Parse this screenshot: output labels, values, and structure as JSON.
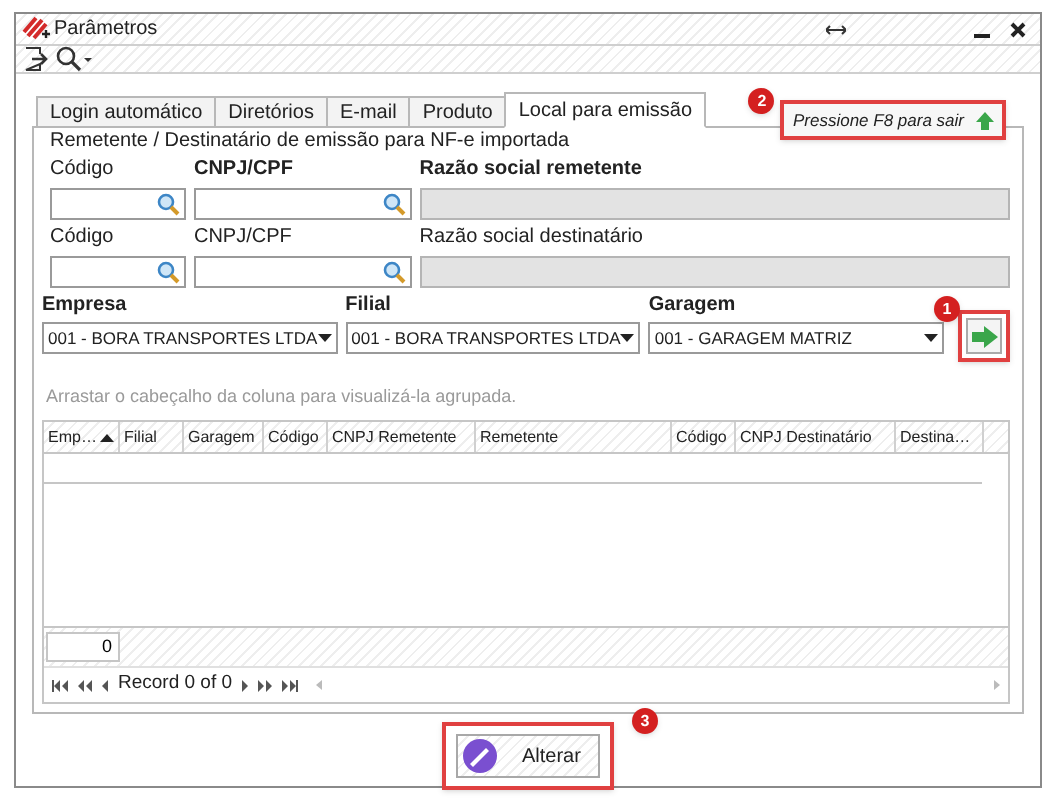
{
  "window": {
    "title": "Parâmetros"
  },
  "tabs": [
    {
      "label": "Login automático",
      "selected": false
    },
    {
      "label": "Diretórios",
      "selected": false
    },
    {
      "label": "E-mail",
      "selected": false
    },
    {
      "label": "Produto",
      "selected": false
    },
    {
      "label": "Local para emissão",
      "selected": true
    }
  ],
  "section_title": "Remetente / Destinatário de emissão para NF-e importada",
  "hint": {
    "text": "Pressione F8 para sair",
    "badge": "2"
  },
  "field_rows": [
    [
      {
        "label": "Código",
        "bold": false,
        "kind": "search"
      },
      {
        "label": "CNPJ/CPF",
        "bold": true,
        "kind": "search"
      },
      {
        "label": "Razão social remetente",
        "bold": true,
        "kind": "readonly"
      }
    ],
    [
      {
        "label": "Código",
        "bold": false,
        "kind": "search"
      },
      {
        "label": "CNPJ/CPF",
        "bold": false,
        "kind": "search"
      },
      {
        "label": "Razão social destinatário",
        "bold": false,
        "kind": "readonly"
      }
    ]
  ],
  "selects": [
    {
      "label": "Empresa",
      "value": "001 - BORA TRANSPORTES LTDA"
    },
    {
      "label": "Filial",
      "value": "001 - BORA TRANSPORTES LTDA"
    },
    {
      "label": "Garagem",
      "value": "001 - GARAGEM MATRIZ"
    }
  ],
  "apply_button": {
    "badge": "1"
  },
  "group_hint": "Arrastar o cabeçalho da coluna para visualizá-la agrupada.",
  "table": {
    "columns": [
      {
        "label": "Emp…",
        "sorted": true
      },
      {
        "label": "Filial",
        "sorted": false
      },
      {
        "label": "Garagem",
        "sorted": false
      },
      {
        "label": "Código",
        "sorted": false
      },
      {
        "label": "CNPJ Remetente",
        "sorted": false
      },
      {
        "label": "Remetente",
        "sorted": false
      },
      {
        "label": "Código",
        "sorted": false
      },
      {
        "label": "CNPJ Destinatário",
        "sorted": false
      },
      {
        "label": "Destina…",
        "sorted": false
      }
    ]
  },
  "footer_count": "0",
  "pager": {
    "text": "Record 0 of 0"
  },
  "alter_button": {
    "label": "Alterar",
    "badge": "3"
  }
}
